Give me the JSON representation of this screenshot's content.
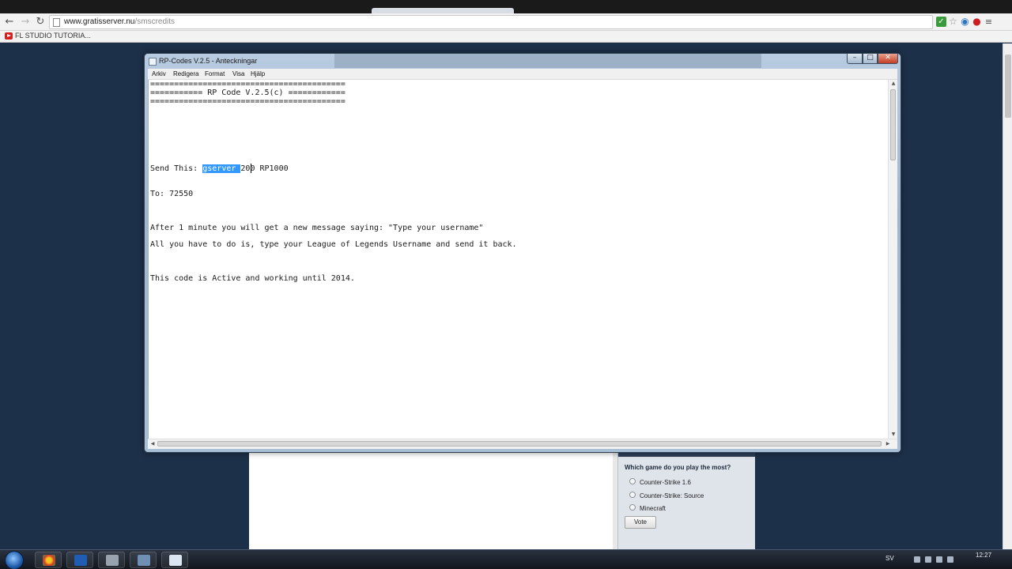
{
  "browser": {
    "url_domain": "www.gratisserver.nu",
    "url_path": "/smscredits",
    "bookmark": "FL STUDIO TUTORIA...",
    "icons": {
      "back": "back-arrow-icon",
      "forward": "forward-arrow-icon",
      "reload": "reload-icon",
      "star": "bookmark-star-icon"
    }
  },
  "notepad": {
    "title": "RP-Codes V.2.5 - Anteckningar",
    "menu": [
      "Arkiv",
      "Redigera",
      "Format",
      "Visa",
      "Hjälp"
    ],
    "lines": {
      "rule": "=========================================",
      "header": "=========== RP Code V.2.5(c) ============",
      "send_label": "Send This: ",
      "send_selected": "gserver ",
      "send_rest": "200 RP1000",
      "to": "To: 72550",
      "after": "After 1 minute you will get a new message saying: \"Type your username\"",
      "all": "All you have to do is, type your League of Legends Username and send it back.",
      "active": "This code is Active and working until 2014."
    },
    "window_buttons": {
      "minimize": "–",
      "maximize": "□",
      "close": "✕"
    }
  },
  "poll": {
    "title": "Which game do you play the most?",
    "options": [
      "Counter-Strike 1.6",
      "Counter-Strike: Source",
      "Minecraft"
    ],
    "vote_label": "Vote"
  },
  "taskbar": {
    "language": "SV",
    "clock": "12:27"
  },
  "colors": {
    "selection": "#3399ff",
    "site_bg": "#1d3049",
    "close_button": "#c63d24"
  }
}
